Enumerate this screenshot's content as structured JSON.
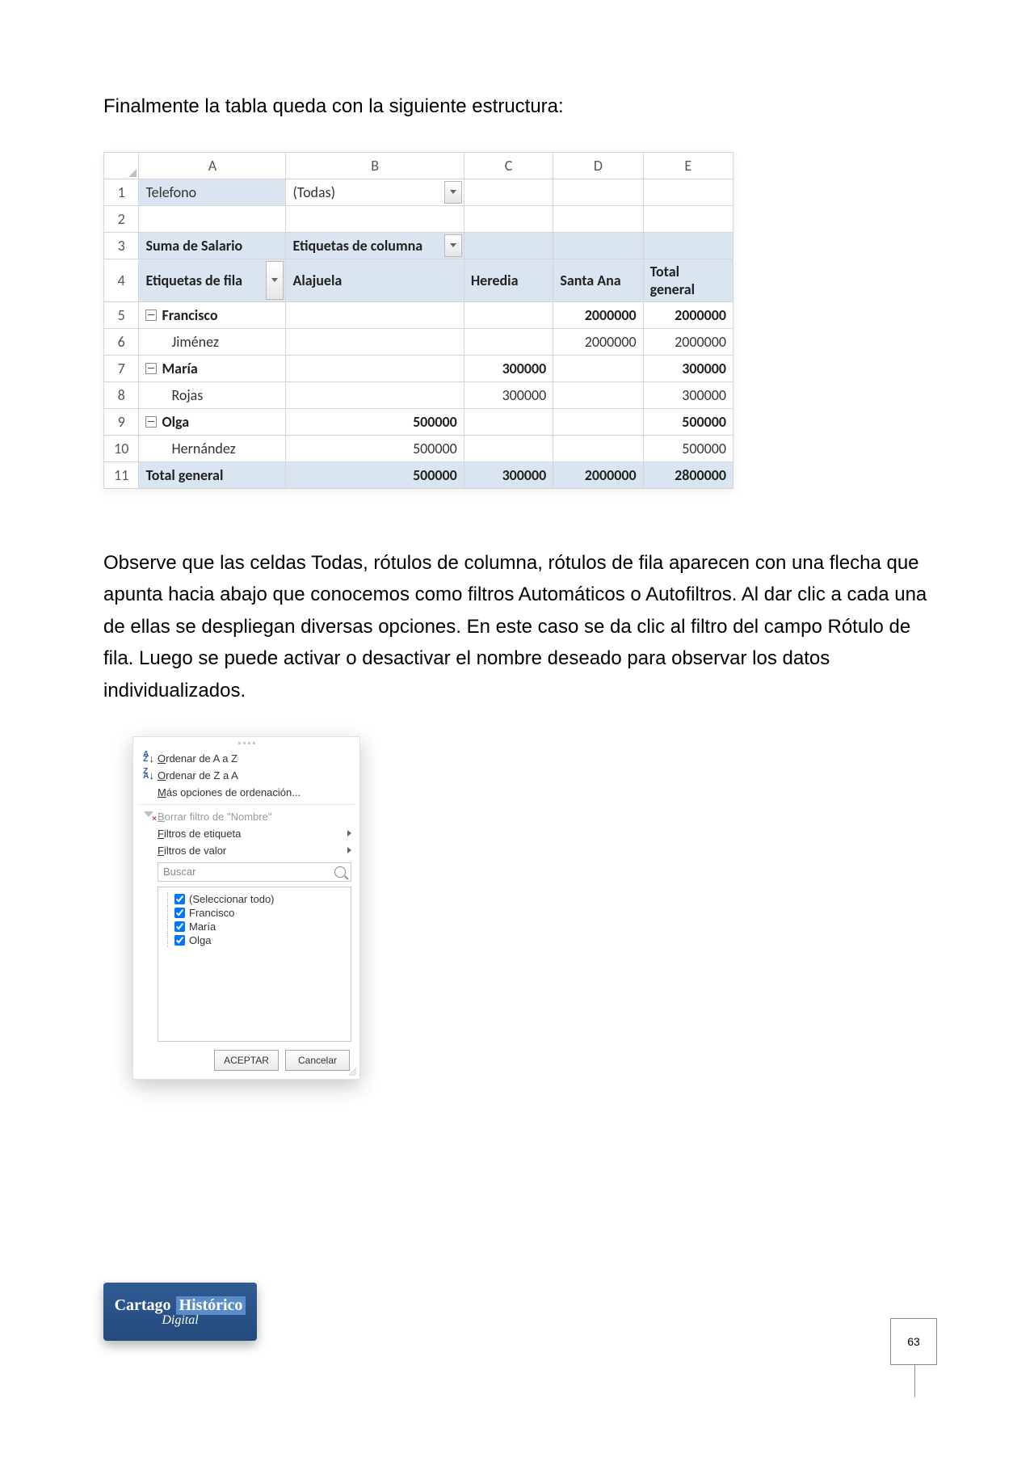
{
  "text": {
    "intro": "Finalmente la tabla queda con la siguiente estructura:",
    "para2": "Observe que las celdas Todas, rótulos de columna, rótulos de fila aparecen con una flecha que apunta hacia abajo que conocemos como filtros Automáticos o Autofiltros. Al dar clic a cada una de ellas se despliegan diversas opciones. En este caso se da clic al filtro del campo Rótulo de fila. Luego se puede activar o desactivar el nombre deseado para observar los datos individualizados."
  },
  "pivot": {
    "col_headers": [
      "A",
      "B",
      "C",
      "D",
      "E"
    ],
    "row1": {
      "label": "Telefono",
      "value": "(Todas)"
    },
    "row3": {
      "a": "Suma de Salario",
      "b": "Etiquetas de columna"
    },
    "row4": {
      "a": "Etiquetas de fila",
      "b": "Alajuela",
      "c": "Heredia",
      "d": "Santa Ana",
      "e": "Total general"
    },
    "data_rows": [
      {
        "n": 5,
        "a": "Francisco",
        "collapse": true,
        "bold": true,
        "b": "",
        "c": "",
        "d": "2000000",
        "e": "2000000"
      },
      {
        "n": 6,
        "a": "Jiménez",
        "collapse": false,
        "bold": false,
        "b": "",
        "c": "",
        "d": "2000000",
        "e": "2000000",
        "indent": true
      },
      {
        "n": 7,
        "a": "María",
        "collapse": true,
        "bold": true,
        "b": "",
        "c": "300000",
        "d": "",
        "e": "300000"
      },
      {
        "n": 8,
        "a": "Rojas",
        "collapse": false,
        "bold": false,
        "b": "",
        "c": "300000",
        "d": "",
        "e": "300000",
        "indent": true
      },
      {
        "n": 9,
        "a": "Olga",
        "collapse": true,
        "bold": true,
        "b": "500000",
        "c": "",
        "d": "",
        "e": "500000"
      },
      {
        "n": 10,
        "a": "Hernández",
        "collapse": false,
        "bold": false,
        "b": "500000",
        "c": "",
        "d": "",
        "e": "500000",
        "indent": true
      }
    ],
    "total_row": {
      "n": 11,
      "a": "Total general",
      "b": "500000",
      "c": "300000",
      "d": "2000000",
      "e": "2800000"
    }
  },
  "filter": {
    "sort_az": "Ordenar de A a Z",
    "sort_za": "Ordenar de Z a A",
    "more_sort": "Más opciones de ordenación...",
    "clear_filter": "Borrar filtro de \"Nombre\"",
    "label_filters": "Filtros de etiqueta",
    "value_filters": "Filtros de valor",
    "search_placeholder": "Buscar",
    "tree": {
      "select_all": "(Seleccionar todo)",
      "items": [
        "Francisco",
        "María",
        "Olga"
      ]
    },
    "accept": "ACEPTAR",
    "cancel": "Cancelar"
  },
  "logo": {
    "word1": "Cartago",
    "word2": "Histórico",
    "word3": "Digital"
  },
  "page_number": "63"
}
